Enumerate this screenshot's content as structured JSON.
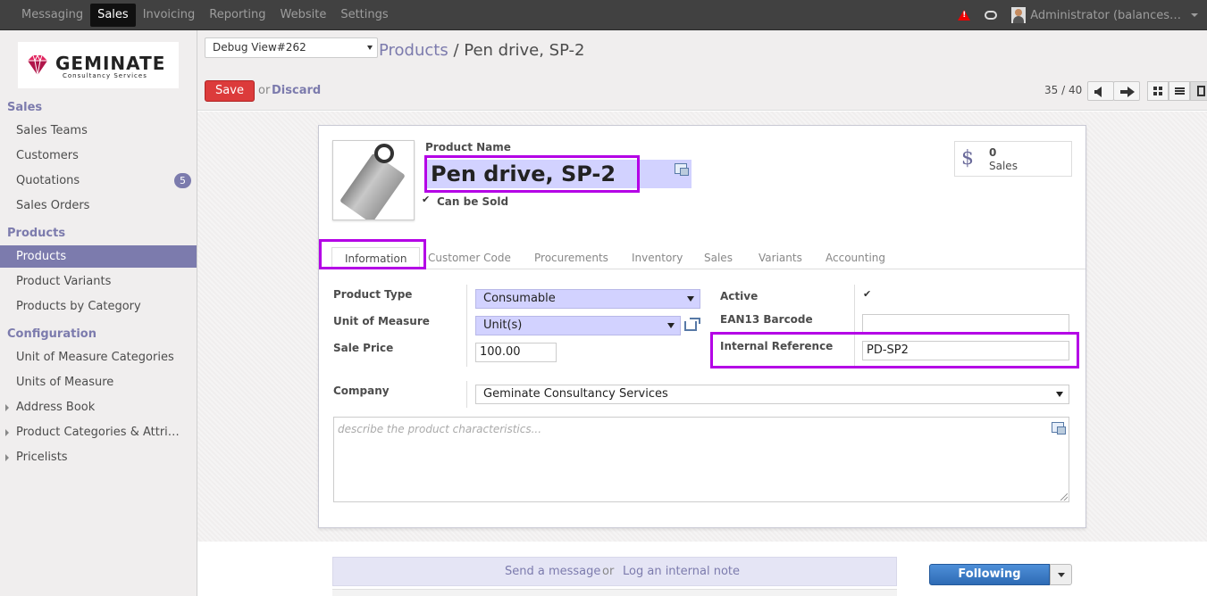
{
  "topbar": {
    "menu": [
      "Messaging",
      "Sales",
      "Invoicing",
      "Reporting",
      "Website",
      "Settings"
    ],
    "active_menu": "Sales",
    "user": "Administrator (balances…"
  },
  "logo": {
    "name": "GEMINATE",
    "tagline": "Consultancy Services"
  },
  "sidebar": {
    "sections": [
      {
        "title": "Sales",
        "items": [
          {
            "label": "Sales Teams"
          },
          {
            "label": "Customers"
          },
          {
            "label": "Quotations",
            "badge": "5"
          },
          {
            "label": "Sales Orders"
          }
        ]
      },
      {
        "title": "Products",
        "items": [
          {
            "label": "Products",
            "active": true
          },
          {
            "label": "Product Variants"
          },
          {
            "label": "Products by Category"
          }
        ]
      },
      {
        "title": "Configuration",
        "items": [
          {
            "label": "Unit of Measure Categories"
          },
          {
            "label": "Units of Measure"
          },
          {
            "label": "Address Book"
          },
          {
            "label": "Product Categories & Attri…"
          },
          {
            "label": "Pricelists"
          }
        ]
      }
    ]
  },
  "control_panel": {
    "debug_view": "Debug View#262",
    "breadcrumb_parent": "Products",
    "breadcrumb_sep": " / ",
    "breadcrumb_current": "Pen drive, SP-2",
    "save_label": "Save",
    "or_label": "or",
    "discard_label": "Discard",
    "pager": "35 / 40"
  },
  "form": {
    "product_name_label": "Product Name",
    "product_name": "Pen drive, SP-2",
    "can_be_sold_label": "Can be Sold",
    "can_be_sold": true,
    "stat": {
      "value": "0",
      "label": "Sales"
    },
    "tabs": [
      "Information",
      "Customer Code",
      "Procurements",
      "Inventory",
      "Sales",
      "Variants",
      "Accounting"
    ],
    "active_tab": "Information",
    "fields": {
      "product_type": {
        "label": "Product Type",
        "value": "Consumable"
      },
      "uom": {
        "label": "Unit of Measure",
        "value": "Unit(s)"
      },
      "sale_price": {
        "label": "Sale Price",
        "value": "100.00"
      },
      "active": {
        "label": "Active",
        "value": true
      },
      "ean13": {
        "label": "EAN13 Barcode",
        "value": ""
      },
      "internal_ref": {
        "label": "Internal Reference",
        "value": "PD-SP2"
      },
      "company": {
        "label": "Company",
        "value": "Geminate Consultancy Services"
      }
    },
    "description_placeholder": "describe the product characteristics..."
  },
  "chatter": {
    "send_message": "Send a message",
    "or_label": "or",
    "log_note": "Log an internal note",
    "following": "Following"
  },
  "colors": {
    "accent": "#7c7bad",
    "highlight": "#b400e6",
    "required_bg": "#d2d2ff",
    "save_red": "#dc3b3b",
    "follow_blue": "#2e6bb5"
  }
}
